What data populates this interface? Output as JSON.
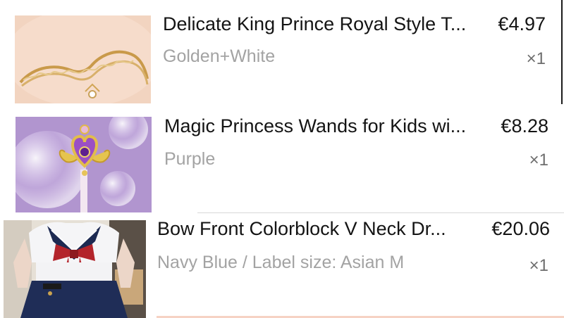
{
  "cart": {
    "items": [
      {
        "title": "Delicate King Prince Royal Style T...",
        "price": "€4.97",
        "variant": "Golden+White",
        "quantity": "×1",
        "thumbnail": "gold-crown-headband-image"
      },
      {
        "title": "Magic Princess Wands for Kids wi...",
        "price": "€8.28",
        "variant": "Purple",
        "quantity": "×1",
        "thumbnail": "princess-wand-image"
      },
      {
        "title": "Bow Front Colorblock V Neck Dr...",
        "price": "€20.06",
        "variant": "Navy Blue / Label size: Asian M",
        "quantity": "×1",
        "thumbnail": "sailor-dress-image"
      }
    ]
  },
  "colors": {
    "title_text": "#141414",
    "variant_text": "#a3a3a3",
    "quantity_text": "#6e6e6e"
  }
}
